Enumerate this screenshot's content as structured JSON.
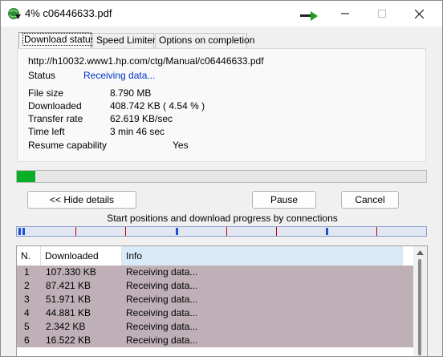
{
  "window": {
    "title": "4% c06446633.pdf"
  },
  "tabs": [
    {
      "label": "Download status",
      "active": true
    },
    {
      "label": "Speed Limiter",
      "active": false
    },
    {
      "label": "Options on completion",
      "active": false
    }
  ],
  "status": {
    "url": "http://h10032.www1.hp.com/ctg/Manual/c06446633.pdf",
    "status_label": "Status",
    "status_value": "Receiving data...",
    "file_size_label": "File size",
    "file_size_value": "8.790  MB",
    "downloaded_label": "Downloaded",
    "downloaded_value": "408.742  KB  ( 4.54 % )",
    "transfer_rate_label": "Transfer rate",
    "transfer_rate_value": "62.619  KB/sec",
    "time_left_label": "Time left",
    "time_left_value": "3 min 46 sec",
    "resume_label": "Resume capability",
    "resume_value": "Yes"
  },
  "progress": {
    "fraction": 0.0454,
    "color": "#06b025"
  },
  "buttons": {
    "hide_details": "<< Hide details",
    "pause": "Pause",
    "cancel": "Cancel"
  },
  "connections_label": "Start positions and download progress by connections",
  "list": {
    "headers": [
      "N.",
      "Downloaded",
      "Info"
    ],
    "rows": [
      {
        "n": "1",
        "downloaded": "107.330  KB",
        "info": "Receiving data..."
      },
      {
        "n": "2",
        "downloaded": "87.421  KB",
        "info": "Receiving data..."
      },
      {
        "n": "3",
        "downloaded": "51.971  KB",
        "info": "Receiving data..."
      },
      {
        "n": "4",
        "downloaded": "44.881  KB",
        "info": "Receiving data..."
      },
      {
        "n": "5",
        "downloaded": "2.342  KB",
        "info": "Receiving data..."
      },
      {
        "n": "6",
        "downloaded": "16.522  KB",
        "info": "Receiving data..."
      }
    ]
  },
  "colors": {
    "status_text": "#0033cc",
    "row_background": "#bfb0b8",
    "header_info_background": "#d9ebf9"
  }
}
